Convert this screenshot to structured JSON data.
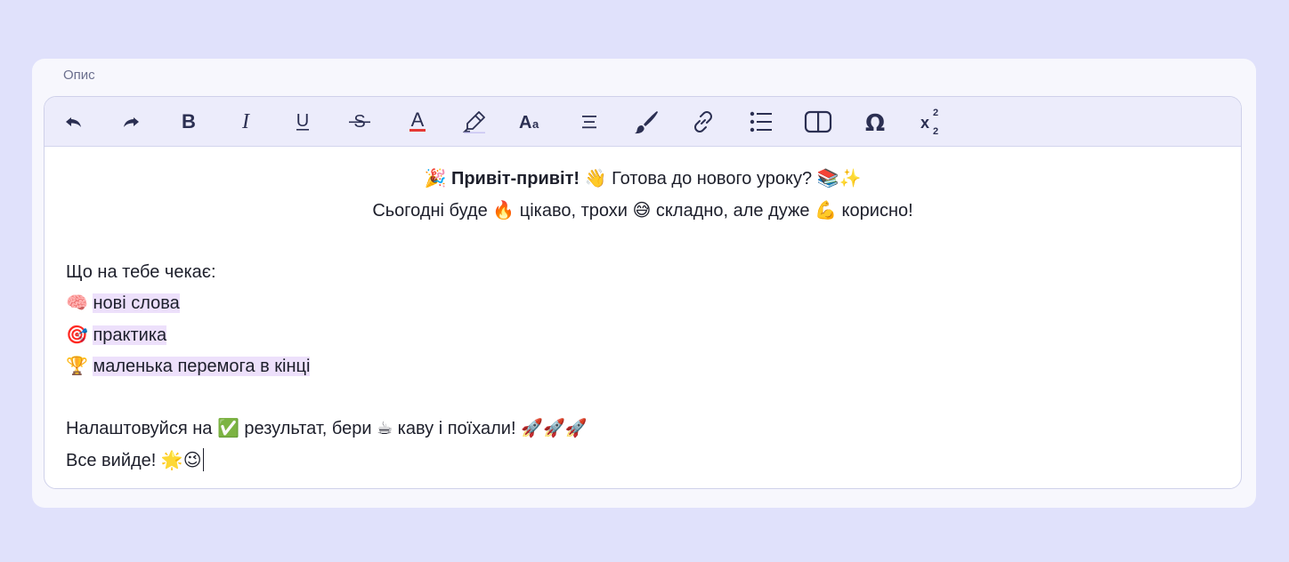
{
  "field": {
    "label": "Опис"
  },
  "toolbar": {
    "buttons": [
      {
        "name": "undo",
        "icon": "undo-icon"
      },
      {
        "name": "redo",
        "icon": "redo-icon"
      },
      {
        "name": "bold",
        "icon": "bold-icon"
      },
      {
        "name": "italic",
        "icon": "italic-icon"
      },
      {
        "name": "underline",
        "icon": "underline-icon"
      },
      {
        "name": "strikethrough",
        "icon": "strikethrough-icon"
      },
      {
        "name": "font-color",
        "icon": "font-color-icon"
      },
      {
        "name": "highlight",
        "icon": "highlighter-icon"
      },
      {
        "name": "font-size",
        "icon": "font-size-icon"
      },
      {
        "name": "align",
        "icon": "align-icon"
      },
      {
        "name": "paint",
        "icon": "brush-icon"
      },
      {
        "name": "link",
        "icon": "link-icon"
      },
      {
        "name": "list",
        "icon": "bullet-list-icon"
      },
      {
        "name": "columns",
        "icon": "columns-icon"
      },
      {
        "name": "special-char",
        "icon": "omega-icon"
      },
      {
        "name": "super-sub",
        "icon": "superscript-subscript-icon"
      }
    ],
    "colors": {
      "font_color_underline": "#e53935",
      "icon": "#2b2f52"
    }
  },
  "content": {
    "line1": {
      "emoji_start": "🎉",
      "bold": "Привіт-привіт!",
      "emoji_wave": "👋",
      "text": "Готова до нового уроку?",
      "emoji_end": "📚✨"
    },
    "line2": {
      "t1": "Сьогодні буде",
      "e1": "🔥",
      "t2": "цікаво, трохи",
      "e2": "😅",
      "t3": "складно, але дуже",
      "e3": "💪",
      "t4": "корисно!"
    },
    "intro": "Що на тебе чекає:",
    "items": [
      {
        "emoji": "🧠",
        "text": "нові слова"
      },
      {
        "emoji": "🎯",
        "text": "практика"
      },
      {
        "emoji": "🏆",
        "text": "маленька перемога в кінці"
      }
    ],
    "outro": {
      "t1": "Налаштовуйся на",
      "e1": "✅",
      "t2": "результат, бери",
      "e2": "☕",
      "t3": "каву і поїхали!",
      "e3": "🚀🚀🚀"
    },
    "final": {
      "text": "Все вийде!",
      "emoji": "🌟😉"
    },
    "highlight_color": "#ede0fb"
  }
}
